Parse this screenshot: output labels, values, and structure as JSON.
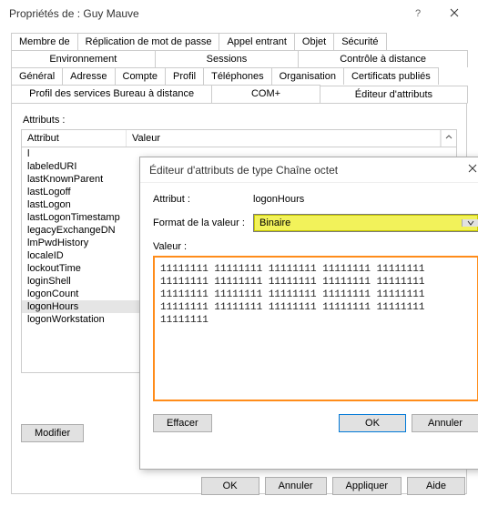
{
  "window": {
    "title": "Propriétés de : Guy Mauve"
  },
  "tabs": {
    "row1": [
      "Membre de",
      "Réplication de mot de passe",
      "Appel entrant",
      "Objet",
      "Sécurité"
    ],
    "row2": [
      "Environnement",
      "Sessions",
      "Contrôle à distance"
    ],
    "row3": [
      "Général",
      "Adresse",
      "Compte",
      "Profil",
      "Téléphones",
      "Organisation",
      "Certificats publiés"
    ],
    "row4": [
      "Profil des services Bureau à distance",
      "COM+",
      "Éditeur d'attributs"
    ],
    "active": "Éditeur d'attributs"
  },
  "panel": {
    "attributs_label": "Attributs :",
    "columns": {
      "attribut": "Attribut",
      "valeur": "Valeur"
    },
    "items": [
      "l",
      "labeledURI",
      "lastKnownParent",
      "lastLogoff",
      "lastLogon",
      "lastLogonTimestamp",
      "legacyExchangeDN",
      "lmPwdHistory",
      "localeID",
      "lockoutTime",
      "loginShell",
      "logonCount",
      "logonHours",
      "logonWorkstation"
    ],
    "selected": "logonHours",
    "modify_label": "Modifier"
  },
  "buttons": {
    "ok": "OK",
    "cancel": "Annuler",
    "apply": "Appliquer",
    "help": "Aide"
  },
  "editor": {
    "title": "Éditeur d'attributs de type Chaîne octet",
    "attr_label": "Attribut :",
    "attr_value": "logonHours",
    "format_label": "Format de la valeur :",
    "format_value": "Binaire",
    "value_label": "Valeur :",
    "value_text": "11111111 11111111 11111111 11111111 11111111\n11111111 11111111 11111111 11111111 11111111\n11111111 11111111 11111111 11111111 11111111\n11111111 11111111 11111111 11111111 11111111\n11111111",
    "clear_label": "Effacer",
    "ok_label": "OK",
    "cancel_label": "Annuler"
  }
}
